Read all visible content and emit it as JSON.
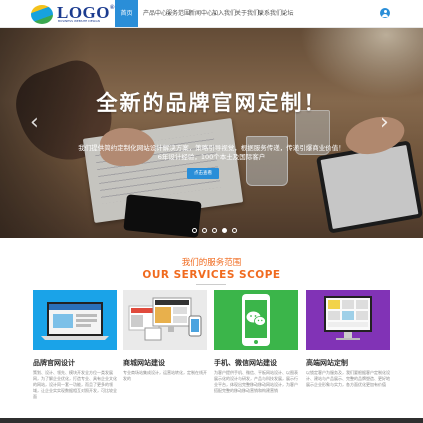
{
  "brand": {
    "logo_text": "LOGO",
    "logo_registered": "®",
    "logo_sub": "BUSINESS WEBSITE DESIGN",
    "accent_color": "#2a8ed8",
    "highlight_color": "#f06a1e"
  },
  "nav": {
    "items": [
      {
        "label": "首页",
        "active": true
      },
      {
        "label": "产品中心",
        "caret": "▾"
      },
      {
        "label": "服务范围"
      },
      {
        "label": "新闻中心",
        "caret": "▾"
      },
      {
        "label": "加入我们"
      },
      {
        "label": "关于我们",
        "caret": "▾"
      },
      {
        "label": "联系我们",
        "caret": "▾"
      },
      {
        "label": "论坛"
      }
    ],
    "user_icon": "user-icon"
  },
  "banner": {
    "title": "全新的品牌官网定制！",
    "subtitle_line1": "我们提供简约定制化网站设计解决方案，策略引导视觉，根据服务传递，传递引爆商业价值！",
    "subtitle_line2": "6年设计经验，100个本土及国际客户",
    "button_label": "点击查看",
    "prev_icon": "chevron-left-icon",
    "next_icon": "chevron-right-icon",
    "slide_count": 5,
    "active_slide": 4
  },
  "services": {
    "title_cn": "我们的服务范围",
    "title_en": "OUR SERVICES SCOPE",
    "cards": [
      {
        "title": "品牌官网设计",
        "desc": "策划、设计、领先、模块开发全方位一类发展网，为了解企业优化，打造专业、具有企业文化的网站，设计同一套一功能，而且了更多的领域，让企业实实现数据相互对照开发，可比较全面"
      },
      {
        "title": "商城网站建设",
        "desc": "专业商场站集成设计，运营站转化，定制在线开发的 "
      },
      {
        "title": "手机、微信网站建设",
        "desc": "为客户提供手机、微信、平板网站设计、以图表展示化的设计与研发，产品与科技发展，展示行业平台，体现出完整移动移动网站设计，为客户搭配完整的移动移动营销和构建营销"
      },
      {
        "title": "高端网站定制",
        "desc": "以锁定客户为服务及，我们要根据客户定制化设计、建站与产品展示、完整的品牌塑造、更好地展示企业形象与实力，各方面优化更加有价值"
      }
    ]
  }
}
